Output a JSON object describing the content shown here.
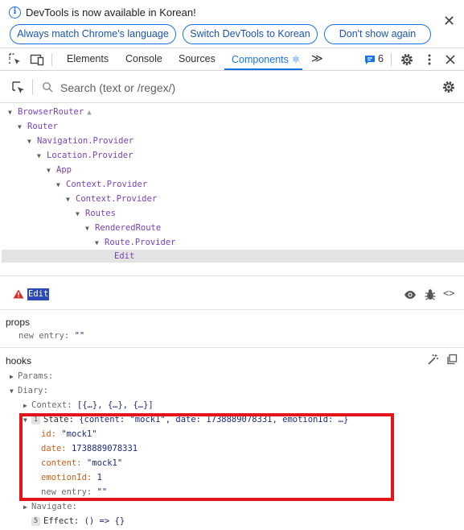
{
  "infobar": {
    "message": "DevTools is now available in Korean!",
    "buttons": [
      "Always match Chrome's language",
      "Switch DevTools to Korean",
      "Don't show again"
    ],
    "close_label": "✕"
  },
  "toolbar": {
    "tabs": [
      "Elements",
      "Console",
      "Sources",
      "Components ⚛"
    ],
    "more_label": "≫",
    "issues_count": "6"
  },
  "search": {
    "placeholder": "Search (text or /regex/)"
  },
  "tree": [
    {
      "label": "BrowserRouter",
      "indent": 0,
      "warn": true
    },
    {
      "label": "Router",
      "indent": 1
    },
    {
      "label": "Navigation.Provider",
      "indent": 2
    },
    {
      "label": "Location.Provider",
      "indent": 3
    },
    {
      "label": "App",
      "indent": 4
    },
    {
      "label": "Context.Provider",
      "indent": 5
    },
    {
      "label": "Context.Provider",
      "indent": 6
    },
    {
      "label": "Routes",
      "indent": 7
    },
    {
      "label": "RenderedRoute",
      "indent": 8
    },
    {
      "label": "Route.Provider",
      "indent": 9
    },
    {
      "label": "Edit",
      "indent": 10,
      "selected": true
    }
  ],
  "inspector": {
    "component_name": "Edit",
    "props_label": "props",
    "props": [
      {
        "key": "new entry",
        "value": "\"\""
      }
    ],
    "hooks_label": "hooks",
    "hooks": {
      "params": "Params:",
      "diary": "Diary:",
      "context": "Context:",
      "context_value": "[{…}, {…}, {…}]",
      "state_badge": "1",
      "state": "State:",
      "state_value": "{content: \"mock1\", date: 1738889078331, emotionId: …}",
      "fields": [
        {
          "key": "id",
          "value": "\"mock1\""
        },
        {
          "key": "date",
          "value": "1738889078331"
        },
        {
          "key": "content",
          "value": "\"mock1\""
        },
        {
          "key": "emotionId",
          "value": "1"
        },
        {
          "key": "new entry",
          "value": "\"\""
        }
      ],
      "navigate": "Navigate:",
      "effect_badge": "5",
      "effect": "Effect:",
      "effect_value": "() => {}"
    }
  },
  "colors": {
    "accent": "#1a73e8",
    "component": "#7a3fb8",
    "highlight": "#e5141a",
    "selection": "#2d49b6"
  }
}
